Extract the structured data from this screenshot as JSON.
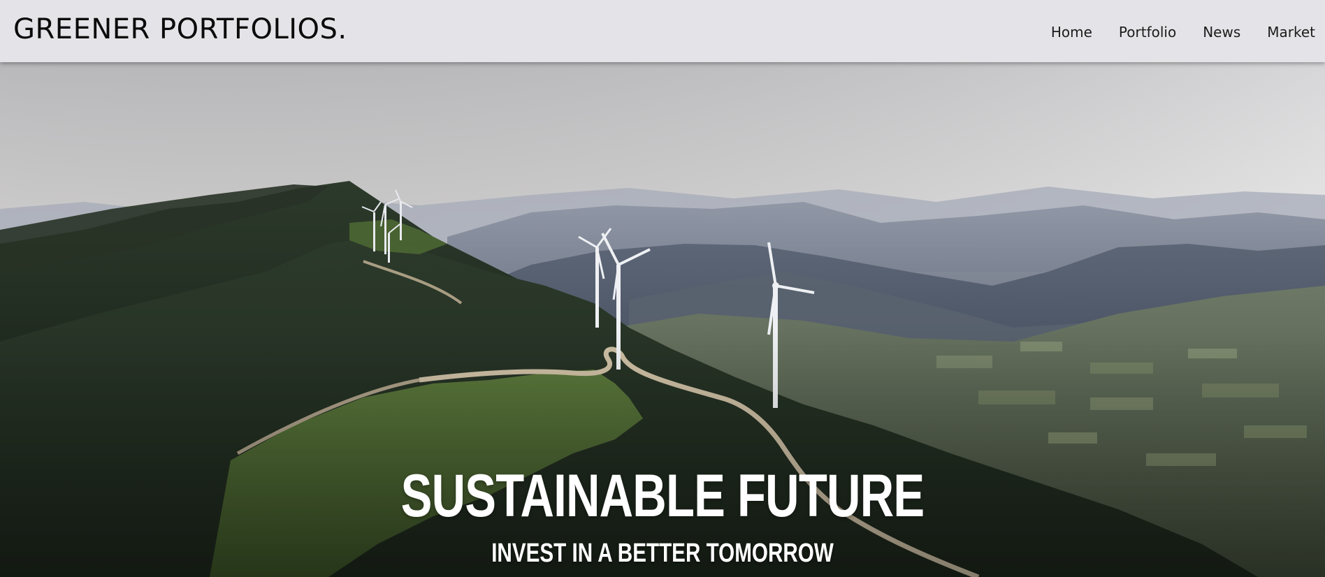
{
  "header": {
    "brand": "GREENER PORTFOLIOS."
  },
  "nav": {
    "items": [
      {
        "label": "Home"
      },
      {
        "label": "Portfolio"
      },
      {
        "label": "News"
      },
      {
        "label": "Market"
      }
    ]
  },
  "hero": {
    "title": "SUSTAINABLE FUTURE",
    "subtitle": "INVEST IN A BETTER TOMORROW",
    "background_image": "wind-turbines-on-green-hills",
    "text_color": "#ffffff"
  },
  "colors": {
    "navbar_bg": "#e4e4e8",
    "brand_text": "#0b0b0b"
  }
}
